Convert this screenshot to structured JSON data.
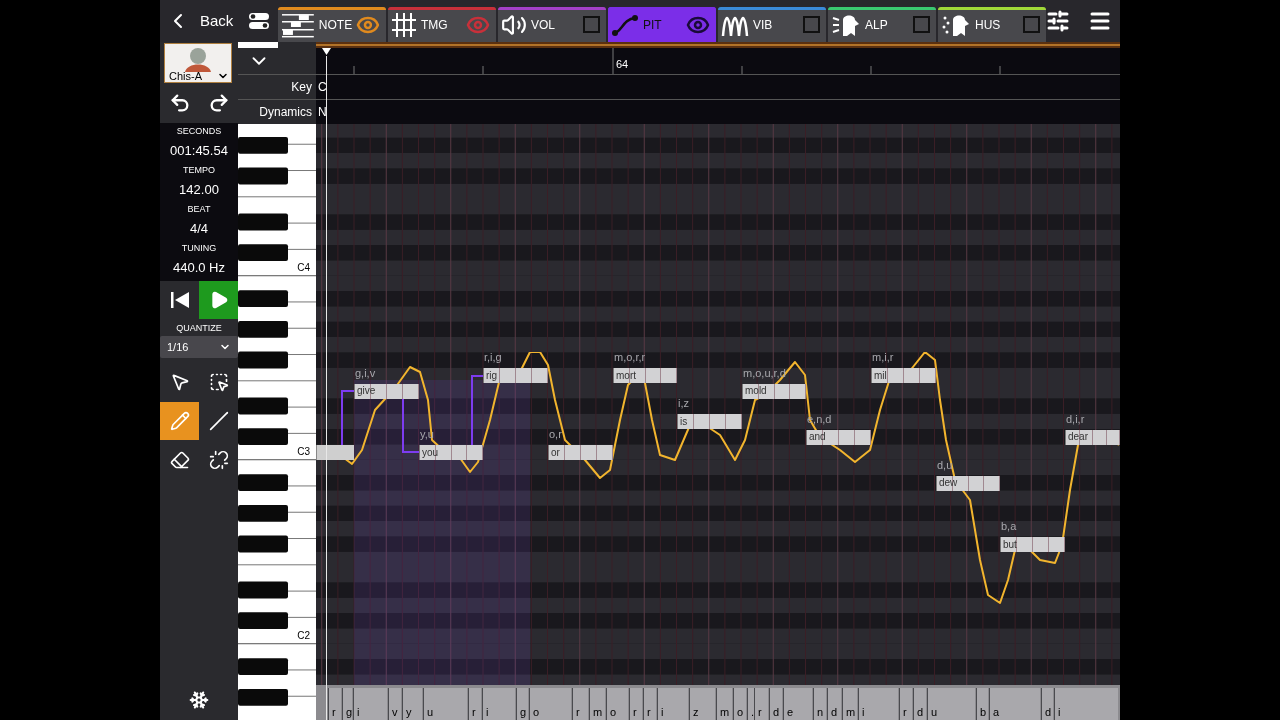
{
  "nav": {
    "back": "Back"
  },
  "tabs": [
    {
      "kind": "note",
      "label": "NOTE",
      "color": "#e08a1e",
      "selected": false,
      "shown": true
    },
    {
      "kind": "timing",
      "label": "TMG",
      "color": "#c8303a",
      "selected": false,
      "shown": true
    },
    {
      "kind": "volume",
      "label": "VOL",
      "color": "#a440c8",
      "selected": false,
      "shown": false
    },
    {
      "kind": "pitch",
      "label": "PIT",
      "color": "#7b2ee8",
      "selected": true,
      "shown": true
    },
    {
      "kind": "vibrato",
      "label": "VIB",
      "color": "#3a8ad8",
      "selected": false,
      "shown": false
    },
    {
      "kind": "alp",
      "label": "ALP",
      "color": "#3ac870",
      "selected": false,
      "shown": false
    },
    {
      "kind": "hus",
      "label": "HUS",
      "color": "#a0d838",
      "selected": false,
      "shown": false
    }
  ],
  "singer": {
    "name": "Chis-A"
  },
  "info": [
    {
      "label": "SECONDS",
      "value": "001:45.54"
    },
    {
      "label": "TEMPO",
      "value": "142.00"
    },
    {
      "label": "BEAT",
      "value": "4/4"
    },
    {
      "label": "TUNING",
      "value": "440.0 Hz"
    }
  ],
  "quantize": {
    "label": "QUANTIZE",
    "value": "1/16"
  },
  "tools": [
    {
      "kind": "pointer",
      "selected": false
    },
    {
      "kind": "box-select",
      "selected": false
    },
    {
      "kind": "pencil",
      "selected": true
    },
    {
      "kind": "line",
      "selected": false
    },
    {
      "kind": "eraser",
      "selected": false
    },
    {
      "kind": "unlink",
      "selected": false
    }
  ],
  "tracks": [
    {
      "label": "Key",
      "value": "C"
    },
    {
      "label": "Dynamics",
      "value": "N"
    }
  ],
  "ruler": {
    "bar": "64"
  },
  "keyboard": {
    "labels": [
      "C4",
      "C3",
      "C2"
    ]
  },
  "notes": [
    {
      "phonemes": "g,i,v",
      "lyric": "give"
    },
    {
      "phonemes": "y,u",
      "lyric": "you"
    },
    {
      "phonemes": "r,i,g",
      "lyric": "rig"
    },
    {
      "phonemes": "o,r",
      "lyric": "or"
    },
    {
      "phonemes": "m,o,r,r",
      "lyric": "mort"
    },
    {
      "phonemes": "i,z",
      "lyric": "is"
    },
    {
      "phonemes": "m,o,u,r,d",
      "lyric": "mold"
    },
    {
      "phonemes": "e,n,d",
      "lyric": "and"
    },
    {
      "phonemes": "m,i,r",
      "lyric": "mil"
    },
    {
      "phonemes": "d,u",
      "lyric": "dew"
    },
    {
      "phonemes": "b,a",
      "lyric": "but"
    },
    {
      "phonemes": "d,i,r",
      "lyric": "dear"
    }
  ],
  "phoneme_track": [
    "r",
    "g",
    "i",
    "v",
    "y",
    "u",
    "r",
    "i",
    "g",
    "o",
    "r",
    "m",
    "o",
    "r",
    "r",
    "i",
    "z",
    "m",
    "o",
    ".",
    "r",
    "d",
    "e",
    "n",
    "d",
    "m",
    "i",
    "r",
    "d",
    "u",
    "b",
    "a",
    "d",
    "i"
  ]
}
